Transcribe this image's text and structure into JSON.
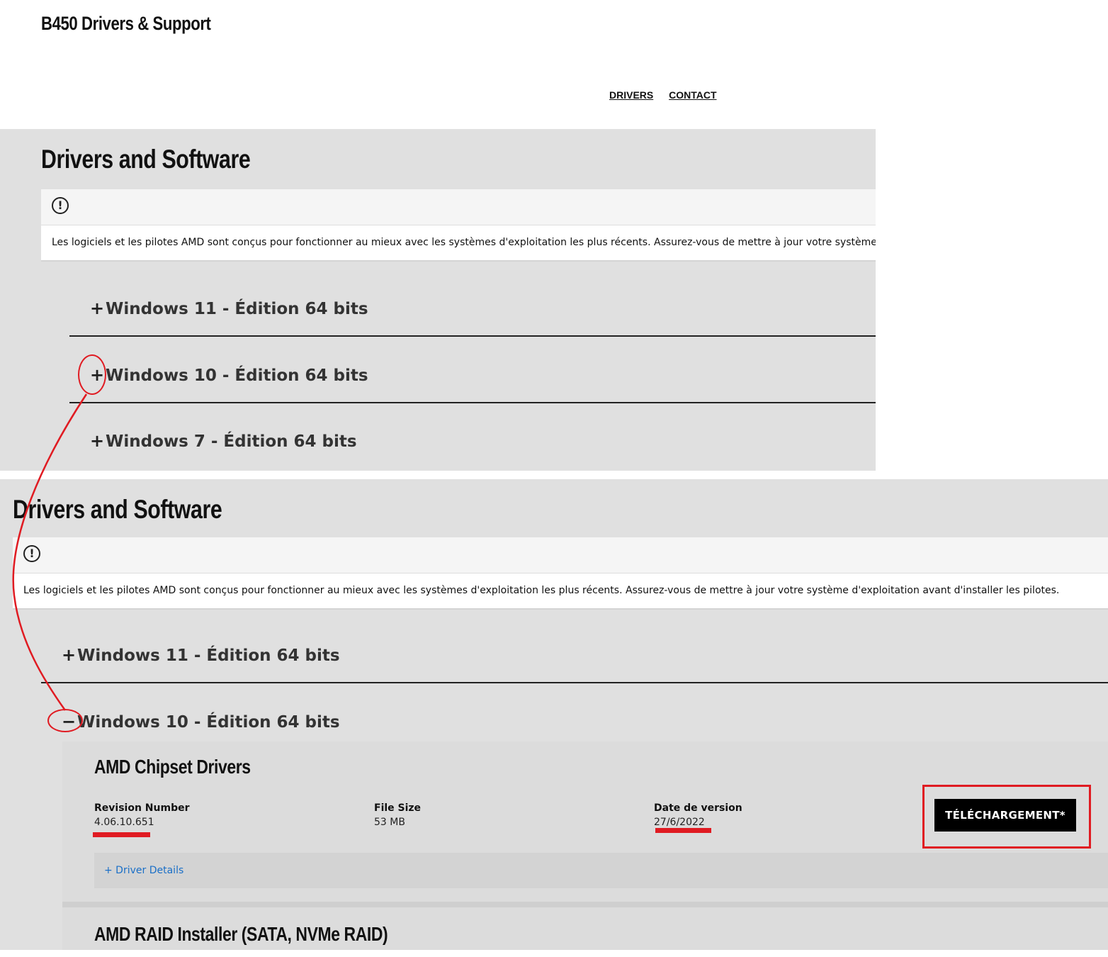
{
  "header": {
    "site_title": "B450 Drivers & Support",
    "nav": [
      "DRIVERS",
      "CONTACT"
    ]
  },
  "panel_top": {
    "title": "Drivers and Software",
    "notice": "Les logiciels et les pilotes AMD sont conçus pour fonctionner au mieux avec les systèmes d'exploitation les plus récents. Assurez-vous de mettre à jour votre système d'exploitatio",
    "os_sections": [
      {
        "symbol": "+",
        "label": "Windows 11 - Édition 64 bits"
      },
      {
        "symbol": "+",
        "label": "Windows 10 - Édition 64 bits"
      },
      {
        "symbol": "+",
        "label": "Windows 7 - Édition 64 bits"
      }
    ]
  },
  "panel_bottom": {
    "title": "Drivers and Software",
    "notice": "Les logiciels et les pilotes AMD sont conçus pour fonctionner au mieux avec les systèmes d'exploitation les plus récents. Assurez-vous de mettre à jour votre système d'exploitation avant d'installer les pilotes.",
    "os_sections": [
      {
        "symbol": "+",
        "label": "Windows 11 - Édition 64 bits"
      },
      {
        "symbol": "−",
        "label": "Windows 10 - Édition 64 bits"
      }
    ],
    "drivers": [
      {
        "title": "AMD Chipset Drivers",
        "revision_label": "Revision Number",
        "revision_value": "4.06.10.651",
        "size_label": "File Size",
        "size_value": "53 MB",
        "date_label": "Date de version",
        "date_value": "27/6/2022",
        "download_label": "TÉLÉCHARGEMENT*",
        "details_label": "+ Driver Details"
      },
      {
        "title": "AMD RAID Installer (SATA, NVMe RAID)"
      }
    ]
  },
  "colors": {
    "panel_bg": "#e0e0e0",
    "annotation_red": "#e01b22",
    "link_blue": "#1a6fc7"
  }
}
